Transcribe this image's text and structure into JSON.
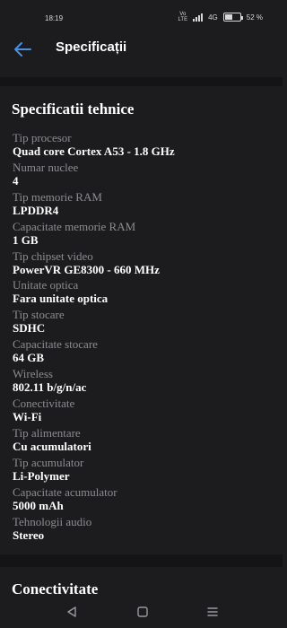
{
  "status": {
    "time": "18:19",
    "volte_top": "Vo",
    "volte_bottom": "LTE",
    "network": "4G",
    "battery_pct": "52 %",
    "battery_level": 0.52
  },
  "header": {
    "title": "Specificații",
    "back_icon": "arrow-left-icon",
    "accent": "#4a8fe0"
  },
  "section": {
    "title": "Specificatii tehnice"
  },
  "specs": [
    {
      "label": "Tip procesor",
      "value": "Quad core Cortex A53 - 1.8 GHz"
    },
    {
      "label": "Numar nuclee",
      "value": "4"
    },
    {
      "label": "Tip memorie RAM",
      "value": "LPDDR4"
    },
    {
      "label": "Capacitate memorie RAM",
      "value": "1 GB"
    },
    {
      "label": "Tip chipset video",
      "value": "PowerVR GE8300 - 660 MHz"
    },
    {
      "label": "Unitate optica",
      "value": "Fara unitate optica"
    },
    {
      "label": "Tip stocare",
      "value": "SDHC"
    },
    {
      "label": "Capacitate stocare",
      "value": "64 GB"
    },
    {
      "label": "Wireless",
      "value": "802.11 b/g/n/ac"
    },
    {
      "label": "Conectivitate",
      "value": "Wi-Fi"
    },
    {
      "label": "Tip alimentare",
      "value": "Cu acumulatori"
    },
    {
      "label": "Tip acumulator",
      "value": "Li-Polymer"
    },
    {
      "label": "Capacitate acumulator",
      "value": "5000 mAh"
    },
    {
      "label": "Tehnologii audio",
      "value": "Stereo"
    }
  ],
  "next_section": {
    "title": "Conectivitate"
  },
  "navbar": {
    "icons": [
      "triangle-back-icon",
      "square-home-icon",
      "menu-lines-icon"
    ]
  }
}
